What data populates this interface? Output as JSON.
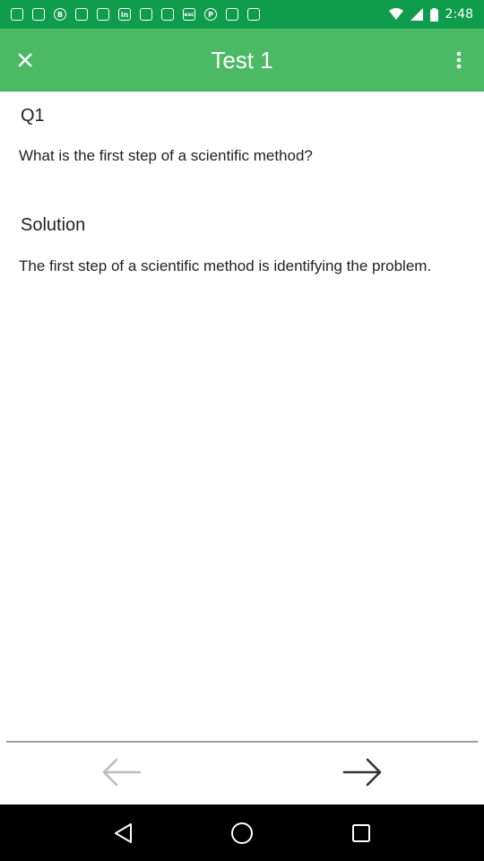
{
  "status_bar": {
    "time": "2:48",
    "notification_icons": [
      "notification-icon",
      "notification-icon",
      "b-icon",
      "notification-icon",
      "notification-icon",
      "linkedin-icon",
      "notification-icon",
      "notification-icon",
      "esc-icon",
      "pinterest-icon",
      "notification-icon",
      "notification-icon"
    ],
    "wifi_icon": "wifi-icon",
    "signal_icon": "signal-icon",
    "battery_icon": "battery-icon"
  },
  "app_bar": {
    "title": "Test 1",
    "close_icon": "close-icon",
    "more_icon": "more-vert-icon",
    "color": "#4cba64"
  },
  "question": {
    "label": "Q1",
    "text": "What is the first step of a scientific method?"
  },
  "solution": {
    "label": "Solution",
    "text": "The first step of a scientific method is identifying the problem."
  },
  "navigation": {
    "prev_icon": "arrow-left-icon",
    "next_icon": "arrow-right-icon"
  },
  "system_nav": {
    "back_icon": "back-triangle-icon",
    "home_icon": "home-circle-icon",
    "recents_icon": "recents-square-icon"
  },
  "colors": {
    "status_bar": "#0f9c4c",
    "app_bar": "#4cba64",
    "text": "#222222"
  }
}
